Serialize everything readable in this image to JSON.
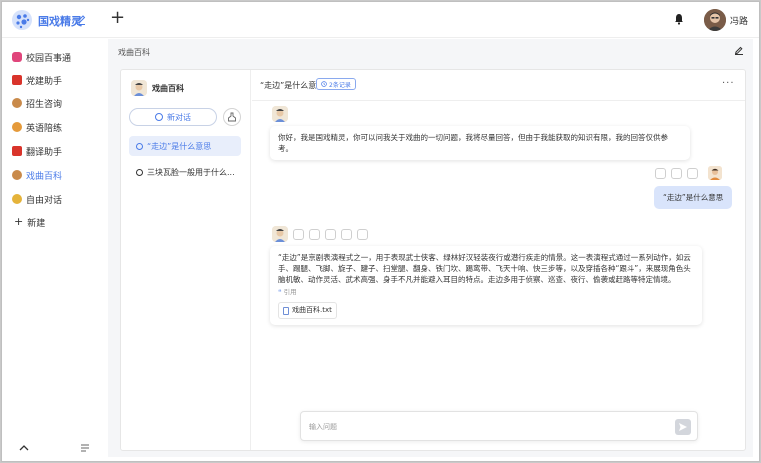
{
  "app": {
    "title": "国戏精灵",
    "user_name": "冯路",
    "accent": "#4a7be8"
  },
  "topbar": {
    "new_label": "+"
  },
  "sidebar": {
    "items": [
      {
        "label": "校园百事通",
        "icon": "question-icon",
        "color": "#e0457b"
      },
      {
        "label": "党建助手",
        "icon": "party-emblem-icon",
        "color": "#d9342b"
      },
      {
        "label": "招生咨询",
        "icon": "person-icon",
        "color": "#c98a4a"
      },
      {
        "label": "英语陪练",
        "icon": "people-icon",
        "color": "#e59a3a"
      },
      {
        "label": "翻译助手",
        "icon": "translate-icon",
        "color": "#d9342b"
      },
      {
        "label": "戏曲百科",
        "icon": "opera-icon",
        "color": "#c98a4a"
      },
      {
        "label": "自由对话",
        "icon": "smile-icon",
        "color": "#e5b33a"
      }
    ],
    "add_label": "新建"
  },
  "main": {
    "header": "戏曲百科"
  },
  "kb": {
    "title": "戏曲百科",
    "new_chat_label": "新对话"
  },
  "conversations": [
    {
      "label": "“走边”是什么意思"
    },
    {
      "label": "三块瓦脸一般用于什么..."
    }
  ],
  "chat": {
    "title": "“走边”是什么意",
    "record_badge": "2条记录",
    "greeting": "你好，我是国戏精灵，你可以问我关于戏曲的一切问题，我将尽量回答，但由于我能获取的知识有限，我的回答仅供参考。",
    "user_question": "“走边”是什么意思",
    "answer": "“走边”是京剧表演程式之一，用于表现武士侠客、绿林好汉轻装夜行或潜行疾走的情景。这一表演程式通过一系列动作，如云手、踢腿、飞脚、旋子、踺子、扫堂腿、翻身、铁门坎、踢鸾带、飞天十响、快三步等，以及穿插各种“跟斗”，来展现角色头脑机敏、动作灵活、武术高强、身手不凡并能避入耳目的特点。走边多用于侦察、巡查、夜行、偷袭或赶路等特定情境。",
    "quote_label": "引用",
    "file_name": "戏曲百科.txt"
  },
  "input": {
    "placeholder": "输入问题"
  }
}
